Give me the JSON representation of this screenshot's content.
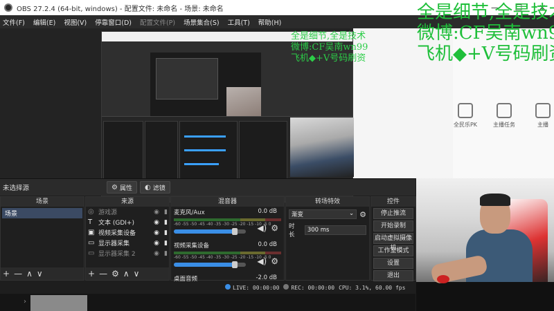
{
  "window": {
    "title": "OBS 27.2.4 (64-bit, windows) - 配置文件: 未命名 - 场景: 未命名",
    "minimize": "—",
    "maximize": "☐",
    "close": "✕"
  },
  "menu": [
    "文件(F)",
    "编辑(E)",
    "视图(V)",
    "停靠窗口(D)",
    "配置文件(P)",
    "场景集合(S)",
    "工具(T)",
    "帮助(H)"
  ],
  "menu_disabled": "配置文件(P)",
  "overlay": {
    "line1": "全是细节,全是技术",
    "line2": "微博:CF吴南wn99",
    "line3": "飞机◆+V号码刷资"
  },
  "overlay_small": {
    "line1": "全是细节,全是技术",
    "line2": "微博:CF吴南wn99",
    "line3": "飞机◆+V号码刷资"
  },
  "side_icons": [
    "全民乐PK",
    "主播任务",
    "主播"
  ],
  "strip": {
    "no_source": "未选择源",
    "properties": "属性",
    "filters": "滤镜"
  },
  "docks": {
    "scenes": {
      "title": "场景",
      "items": [
        "场景"
      ]
    },
    "sources": {
      "title": "来源",
      "items": [
        {
          "icon": "◎",
          "name": "游戏源",
          "dim": true
        },
        {
          "icon": "T",
          "name": "文本 (GDI+)",
          "dim": false
        },
        {
          "icon": "▣",
          "name": "视频采集设备",
          "dim": false
        },
        {
          "icon": "▭",
          "name": "显示器采集",
          "dim": false
        },
        {
          "icon": "▭",
          "name": "显示器采集 2",
          "dim": true
        }
      ]
    },
    "mixer": {
      "title": "混音器",
      "channels": [
        {
          "name": "麦克风/Aux",
          "db": "0.0 dB",
          "level": 0.85
        },
        {
          "name": "视频采集设备",
          "db": "0.0 dB",
          "level": 0.85
        },
        {
          "name": "桌面音频",
          "db": "-2.0 dB",
          "level": 0.78
        }
      ],
      "ticks": "-60 -55 -50 -45 -40 -35 -30 -25 -20 -15 -10 -5 0"
    },
    "transitions": {
      "title": "转场特效",
      "selected": "渐变",
      "duration_label": "时长",
      "duration_value": "300 ms"
    },
    "controls": {
      "title": "控件",
      "buttons": [
        "停止推流",
        "开始录制",
        "启动虚拟摄像机",
        "工作室模式",
        "设置",
        "退出"
      ]
    }
  },
  "status": {
    "live": "LIVE: 00:00:00",
    "rec": "REC: 00:00:00",
    "cpu": "CPU: 3.1%, 60.00 fps"
  },
  "colors": {
    "overlay_green": "#1fbf3a",
    "panel_bg": "#1f1f1f",
    "accent_blue": "#3a8ee6"
  }
}
